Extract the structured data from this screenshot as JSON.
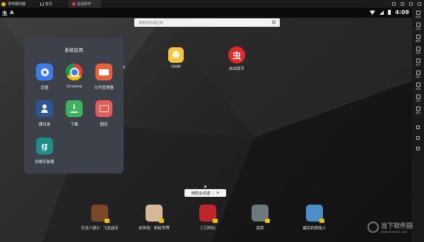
{
  "titlebar": {
    "app_name": "雷电模拟器",
    "tabs": [
      {
        "label": "首页",
        "icon": "home-icon",
        "active": false
      },
      {
        "label": "虫虫助手",
        "icon": "app-icon",
        "active": true
      }
    ]
  },
  "statusbar": {
    "left_a": "虫",
    "left_b": "A",
    "time": "4:09"
  },
  "search": {
    "placeholder": "搜索游戏或应用"
  },
  "desktop": {
    "icons": [
      {
        "label": "OGM",
        "icon": "ogm-icon"
      },
      {
        "label": "虫虫助手",
        "icon": "chongchong-icon"
      }
    ]
  },
  "folder": {
    "title": "系统应用",
    "apps": [
      {
        "label": "设置",
        "icon": "settings-gear-icon",
        "color": "#3a7de8"
      },
      {
        "label": "Chrome",
        "icon": "chrome-icon"
      },
      {
        "label": "文件管理器",
        "icon": "file-manager-icon",
        "color": "#e8603c"
      },
      {
        "label": "通讯录",
        "icon": "contacts-icon",
        "color": "#2f5599"
      },
      {
        "label": "下载",
        "icon": "download-icon",
        "color": "#3db25c"
      },
      {
        "label": "图库",
        "icon": "gallery-icon",
        "color": "#e95b58"
      },
      {
        "label": "谷歌安装器",
        "icon": "google-installer-icon",
        "color": "#1f8f8a",
        "glyph": "g"
      }
    ]
  },
  "banner": {
    "text": "举职业传奇",
    "close_glyph": "✕"
  },
  "dock": [
    {
      "label": "天龙八部2：飞龙战天",
      "color": "#7a4a28"
    },
    {
      "label": "永恒岛：彩虹世界",
      "color": "#d6b89a"
    },
    {
      "label": "三刀时石",
      "color": "#c0272d"
    },
    {
      "label": "亮剑",
      "color": "#6b7a7e"
    },
    {
      "label": "最后的原始人",
      "color": "#4a8fc8"
    }
  ],
  "rightbar": {
    "items": [
      "按键",
      "全屏",
      "截图",
      "录屏",
      "多开",
      "同步",
      "安装",
      "共享",
      "更多"
    ]
  },
  "watermark": {
    "name": "当下软件园",
    "url": "www.downxia.com"
  }
}
